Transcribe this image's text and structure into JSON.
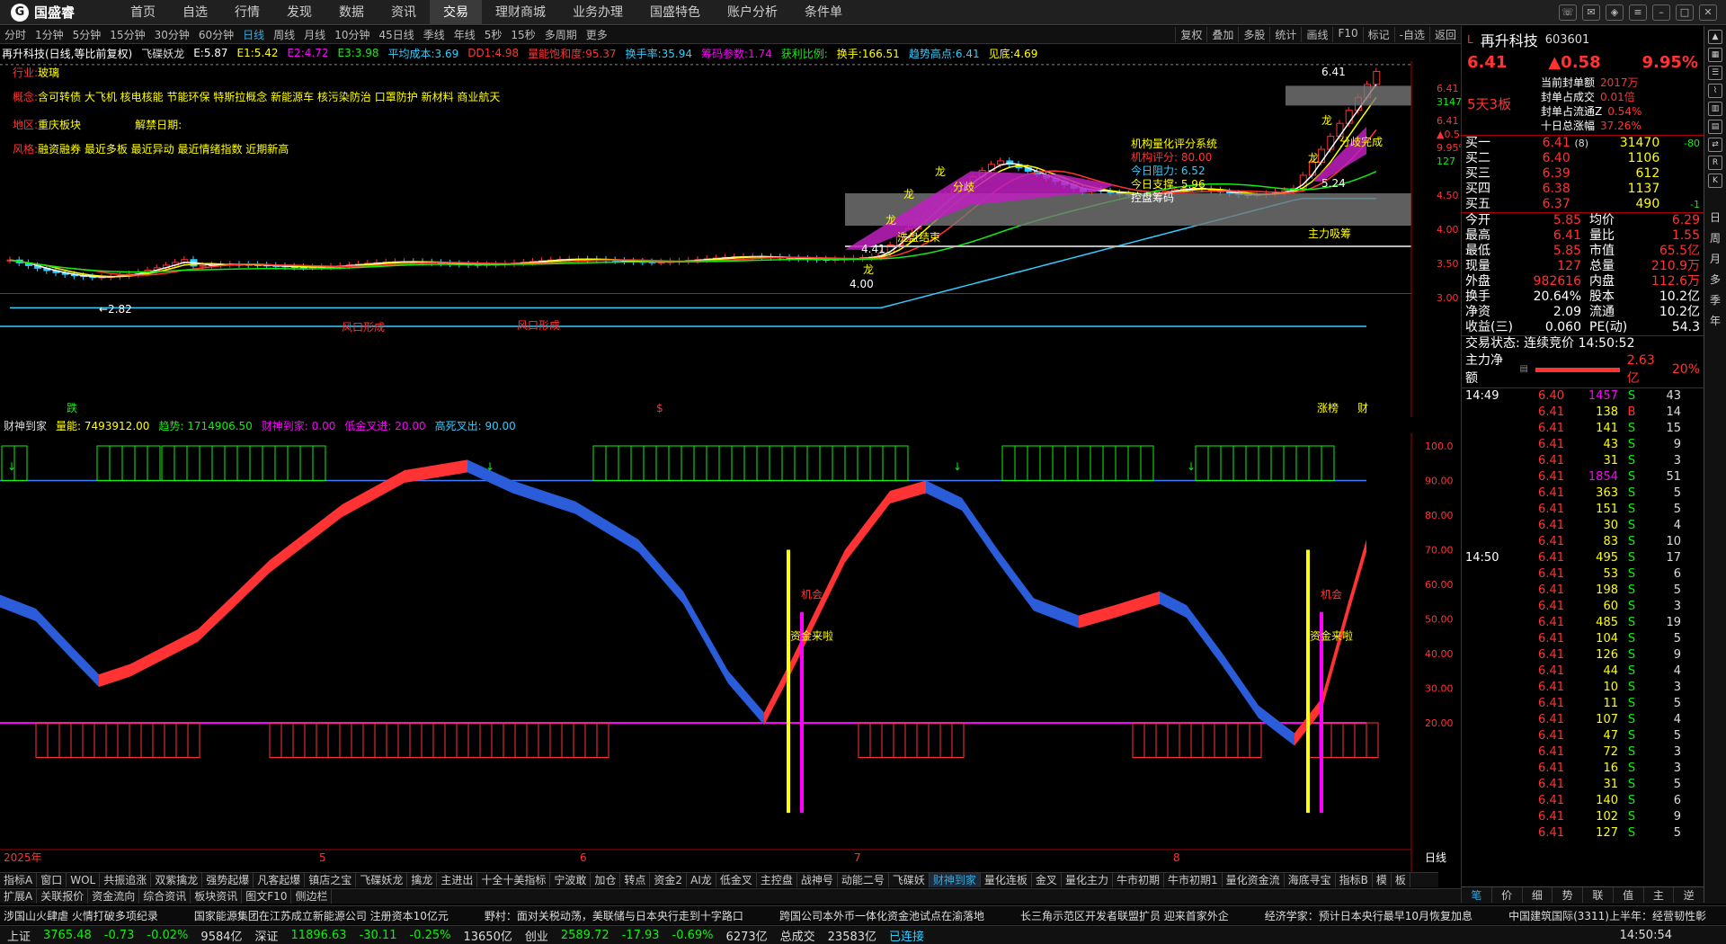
{
  "menubar": {
    "logo": "国盛睿",
    "items": [
      "首页",
      "自选",
      "行情",
      "发现",
      "数据",
      "资讯",
      "交易",
      "理财商城",
      "业务办理",
      "国盛特色",
      "账户分析",
      "条件单"
    ],
    "active": "交易"
  },
  "periods": {
    "items": [
      "分时",
      "1分钟",
      "5分钟",
      "15分钟",
      "30分钟",
      "60分钟",
      "日线",
      "周线",
      "月线",
      "10分钟",
      "45日线",
      "季线",
      "年线",
      "5秒",
      "15秒",
      "多周期",
      "更多"
    ],
    "active": "日线",
    "tools": [
      "复权",
      "叠加",
      "多股",
      "统计",
      "画线",
      "F10",
      "标记",
      "-自选",
      "返回"
    ]
  },
  "indicator": {
    "title": "再升科技(日线,等比前复权)",
    "items": [
      {
        "t": "飞碟妖龙",
        "c": "#ddd"
      },
      {
        "t": "E:5.87",
        "c": "#fff"
      },
      {
        "t": "E1:5.42",
        "c": "#ff0"
      },
      {
        "t": "E2:4.72",
        "c": "#f0f"
      },
      {
        "t": "E3:3.98",
        "c": "#1e1"
      },
      {
        "t": "平均成本:3.69",
        "c": "#3cf"
      },
      {
        "t": "DD1:4.98",
        "c": "#f33"
      },
      {
        "t": "量能饱和度:95.37",
        "c": "#f33"
      },
      {
        "t": "换手率:35.94",
        "c": "#3cf"
      },
      {
        "t": "筹码参数:1.74",
        "c": "#f0f"
      },
      {
        "t": "获利比例:",
        "c": "#1e1"
      },
      {
        "t": "换手:166.51",
        "c": "#ff0"
      },
      {
        "t": "趋势高点:6.41",
        "c": "#3cf"
      },
      {
        "t": "见底:4.69",
        "c": "#ff0"
      }
    ]
  },
  "info": {
    "rows": [
      {
        "k": "行业:",
        "v": "玻璃"
      },
      {
        "k": "概念:",
        "v": "含可转债 大飞机 核电核能 节能环保 特斯拉概念 新能源车 核污染防治 口罩防护 新材料 商业航天"
      },
      {
        "k": "地区:",
        "v": "重庆板块",
        "extra": "解禁日期:"
      },
      {
        "k": "风格:",
        "v": "融资融券 最近多板 最近异动 最近情绪指数 近期新高"
      }
    ]
  },
  "rating": {
    "title": "机构量化评分系统",
    "score": "机构评分: 80.00",
    "resist": "今日阻力: 6.52",
    "support": "今日支撑: 5.96",
    "control": "控盘筹码"
  },
  "chart_labels": {
    "low": "←2.82",
    "dragon": "龙",
    "wash": "洗盘结束",
    "fenqi": "分歧",
    "zhuli": "主力吸筹",
    "fenqi2": "分歧完成",
    "fengkou": "风口形成",
    "p441": "4.41",
    "p400": "4.00",
    "p641": "6.41",
    "p524": "5.24",
    "zhangbang": "涨榜",
    "cai": "财",
    "die": "跌",
    "dollar": "$"
  },
  "yaxis": {
    "main": [
      "6.41",
      "31470",
      "6.41",
      "▲0.58",
      "9.95%",
      "127",
      "4.50",
      "4.00",
      "3.50",
      "3.00"
    ],
    "sub": [
      "100.0",
      "90.00",
      "80.00",
      "70.00",
      "60.00",
      "50.00",
      "40.00",
      "30.00",
      "20.00"
    ]
  },
  "subind": {
    "items": [
      {
        "t": "财神到家",
        "c": "#ddd"
      },
      {
        "t": "量能: 7493912.00",
        "c": "#ff0"
      },
      {
        "t": "趋势: 1714906.50",
        "c": "#1e1"
      },
      {
        "t": "财神到家: 0.00",
        "c": "#f0f"
      },
      {
        "t": "低金叉进: 20.00",
        "c": "#f0f"
      },
      {
        "t": "高死叉出: 90.00",
        "c": "#3cf"
      }
    ],
    "jihui": "机会",
    "zijin": "资金来啦"
  },
  "xaxis": {
    "labels": [
      "2025年",
      "5",
      "6",
      "7",
      "8"
    ],
    "right": "日线"
  },
  "bottomtabs": [
    "指标A",
    "窗口",
    "WOL",
    "共振追涨",
    "双紫擒龙",
    "强势起爆",
    "凡客起爆",
    "镇店之宝",
    "飞碟妖龙",
    "擒龙",
    "主进出",
    "十全十美指标",
    "宁波敢",
    "加仓",
    "转点",
    "资金2",
    "AI龙",
    "低金叉",
    "主控盘",
    "战神号",
    "动能二号",
    "飞碟妖",
    "财神到家",
    "量化连板",
    "金叉",
    "量化主力",
    "牛市初期",
    "牛市初期1",
    "量化资金流",
    "海底寻宝",
    "指标B",
    "模",
    "板"
  ],
  "bottomtabs_active": "财神到家",
  "bottomtabs2": [
    "扩展A",
    "关联报价",
    "资金流向",
    "综合资讯",
    "板块资讯",
    "图文F10",
    "侧边栏"
  ],
  "news": [
    "涉国山火肆虐 火情打破多项纪录",
    "国家能源集团在江苏成立新能源公司 注册资本10亿元",
    "野村：面对关税动荡，美联储与日本央行走到十字路口",
    "跨国公司本外币一体化资金池试点在渝落地",
    "长三角示范区开发者联盟扩员 迎来首家外企",
    "经济学家：预计日本央行最早10月恢复加息",
    "中国建筑国际(3311)上半年：经营韧性彰"
  ],
  "status": {
    "sh": "上证",
    "sh_v": "3765.48",
    "sh_c": "-0.73",
    "sh_p": "-0.02%",
    "sh_a": "9584亿",
    "sz": "深证",
    "sz_v": "11896.63",
    "sz_c": "-30.11",
    "sz_p": "-0.25%",
    "sz_a": "13650亿",
    "cy": "创业",
    "cy_v": "2589.72",
    "cy_c": "-17.93",
    "cy_p": "-0.69%",
    "cy_a": "6273亿",
    "total": "总成交",
    "total_v": "23583亿",
    "conn": "已连接",
    "time": "14:50:54"
  },
  "stock": {
    "name": "再升科技",
    "code": "603601",
    "price": "6.41",
    "chg": "▲0.58",
    "pct": "9.95%",
    "board": "5天3板",
    "seal": [
      [
        "当前封单额",
        "2017万"
      ],
      [
        "封单占成交",
        "0.01倍"
      ],
      [
        "封单占流通Z",
        "0.54%"
      ],
      [
        "十日总涨幅",
        "37.26%"
      ]
    ]
  },
  "orderbook": [
    {
      "l": "买一",
      "p": "6.41",
      "n": "(8)",
      "v": "31470",
      "d": "-80"
    },
    {
      "l": "买二",
      "p": "6.40",
      "n": "",
      "v": "1106",
      "d": ""
    },
    {
      "l": "买三",
      "p": "6.39",
      "n": "",
      "v": "612",
      "d": ""
    },
    {
      "l": "买四",
      "p": "6.38",
      "n": "",
      "v": "1137",
      "d": ""
    },
    {
      "l": "买五",
      "p": "6.37",
      "n": "",
      "v": "490",
      "d": "-1"
    }
  ],
  "stats": [
    [
      "今开",
      "5.85",
      "均价",
      "6.29"
    ],
    [
      "最高",
      "6.41",
      "量比",
      "1.55"
    ],
    [
      "最低",
      "5.85",
      "市值",
      "65.5亿"
    ],
    [
      "现量",
      "127",
      "总量",
      "210.9万"
    ],
    [
      "外盘",
      "982616",
      "内盘",
      "112.6万"
    ],
    [
      "换手",
      "20.64%",
      "股本",
      "10.2亿"
    ],
    [
      "净资",
      "2.09",
      "流通",
      "10.2亿"
    ],
    [
      "收益(三)",
      "0.060",
      "PE(动)",
      "54.3"
    ]
  ],
  "trade_status": "交易状态: 连续竞价 14:50:52",
  "netflow": {
    "label": "主力净额",
    "value": "2.63亿",
    "pct": "20%"
  },
  "ticks": [
    {
      "t": "14:49",
      "p": "6.40",
      "v": "1457",
      "s": "S",
      "n": "43"
    },
    {
      "t": "",
      "p": "6.41",
      "v": "138",
      "s": "B",
      "n": "14"
    },
    {
      "t": "",
      "p": "6.41",
      "v": "141",
      "s": "S",
      "n": "15"
    },
    {
      "t": "",
      "p": "6.41",
      "v": "43",
      "s": "S",
      "n": "9"
    },
    {
      "t": "",
      "p": "6.41",
      "v": "31",
      "s": "S",
      "n": "3"
    },
    {
      "t": "",
      "p": "6.41",
      "v": "1854",
      "s": "S",
      "n": "51"
    },
    {
      "t": "",
      "p": "6.41",
      "v": "363",
      "s": "S",
      "n": "5"
    },
    {
      "t": "",
      "p": "6.41",
      "v": "151",
      "s": "S",
      "n": "5"
    },
    {
      "t": "",
      "p": "6.41",
      "v": "30",
      "s": "S",
      "n": "4"
    },
    {
      "t": "",
      "p": "6.41",
      "v": "83",
      "s": "S",
      "n": "10"
    },
    {
      "t": "14:50",
      "p": "6.41",
      "v": "495",
      "s": "S",
      "n": "17"
    },
    {
      "t": "",
      "p": "6.41",
      "v": "53",
      "s": "S",
      "n": "6"
    },
    {
      "t": "",
      "p": "6.41",
      "v": "198",
      "s": "S",
      "n": "5"
    },
    {
      "t": "",
      "p": "6.41",
      "v": "60",
      "s": "S",
      "n": "3"
    },
    {
      "t": "",
      "p": "6.41",
      "v": "485",
      "s": "S",
      "n": "19"
    },
    {
      "t": "",
      "p": "6.41",
      "v": "104",
      "s": "S",
      "n": "5"
    },
    {
      "t": "",
      "p": "6.41",
      "v": "126",
      "s": "S",
      "n": "9"
    },
    {
      "t": "",
      "p": "6.41",
      "v": "44",
      "s": "S",
      "n": "4"
    },
    {
      "t": "",
      "p": "6.41",
      "v": "10",
      "s": "S",
      "n": "3"
    },
    {
      "t": "",
      "p": "6.41",
      "v": "11",
      "s": "S",
      "n": "5"
    },
    {
      "t": "",
      "p": "6.41",
      "v": "107",
      "s": "S",
      "n": "4"
    },
    {
      "t": "",
      "p": "6.41",
      "v": "47",
      "s": "S",
      "n": "5"
    },
    {
      "t": "",
      "p": "6.41",
      "v": "72",
      "s": "S",
      "n": "3"
    },
    {
      "t": "",
      "p": "6.41",
      "v": "16",
      "s": "S",
      "n": "3"
    },
    {
      "t": "",
      "p": "6.41",
      "v": "31",
      "s": "S",
      "n": "5"
    },
    {
      "t": "",
      "p": "6.41",
      "v": "140",
      "s": "S",
      "n": "6"
    },
    {
      "t": "",
      "p": "6.41",
      "v": "102",
      "s": "S",
      "n": "9"
    },
    {
      "t": "",
      "p": "6.41",
      "v": "127",
      "s": "S",
      "n": "5"
    }
  ],
  "rp_tabs": [
    "笔",
    "价",
    "细",
    "势",
    "联",
    "值",
    "主",
    "逆"
  ],
  "sidebar_text": [
    "日",
    "周",
    "月",
    "多",
    "季",
    "年"
  ],
  "colors": {
    "up": "#ff3333",
    "down": "#1ee61e",
    "blue": "#2b5cd9",
    "magenta": "#c020c0",
    "cyan": "#33ccff"
  }
}
